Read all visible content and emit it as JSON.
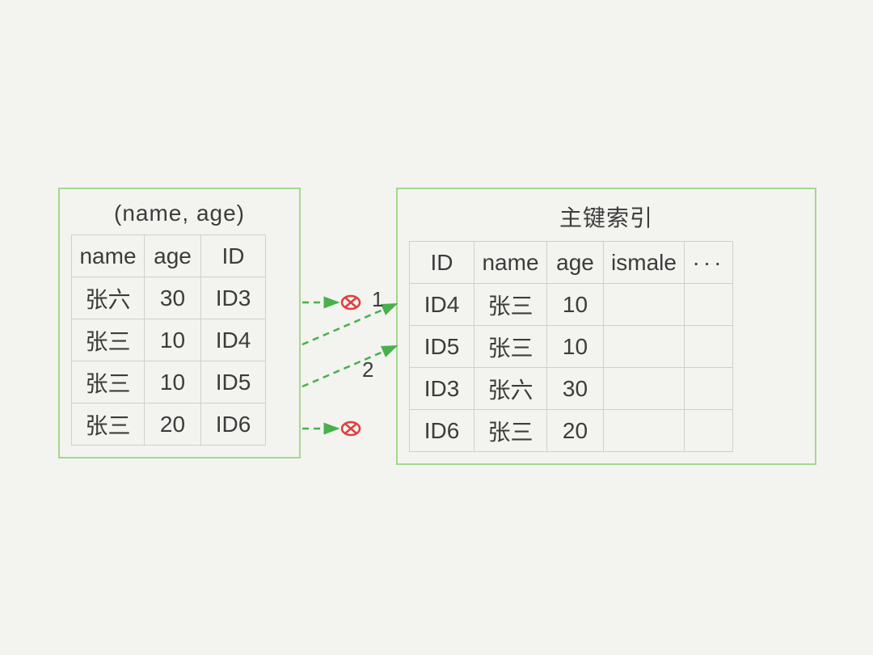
{
  "left": {
    "title": "(name, age)",
    "headers": [
      "name",
      "age",
      "ID"
    ],
    "rows": [
      [
        "张六",
        "30",
        "ID3"
      ],
      [
        "张三",
        "10",
        "ID4"
      ],
      [
        "张三",
        "10",
        "ID5"
      ],
      [
        "张三",
        "20",
        "ID6"
      ]
    ]
  },
  "right": {
    "title": "主键索引",
    "headers": [
      "ID",
      "name",
      "age",
      "ismale",
      "···"
    ],
    "rows": [
      [
        "ID4",
        "张三",
        "10",
        "",
        ""
      ],
      [
        "ID5",
        "张三",
        "10",
        "",
        ""
      ],
      [
        "ID3",
        "张六",
        "30",
        "",
        ""
      ],
      [
        "ID6",
        "张三",
        "20",
        "",
        ""
      ]
    ]
  },
  "annotations": {
    "label1": "1",
    "label2": "2"
  },
  "colors": {
    "border": "#a3d890",
    "arrow": "#49b04d",
    "x": "#e13d3d"
  }
}
